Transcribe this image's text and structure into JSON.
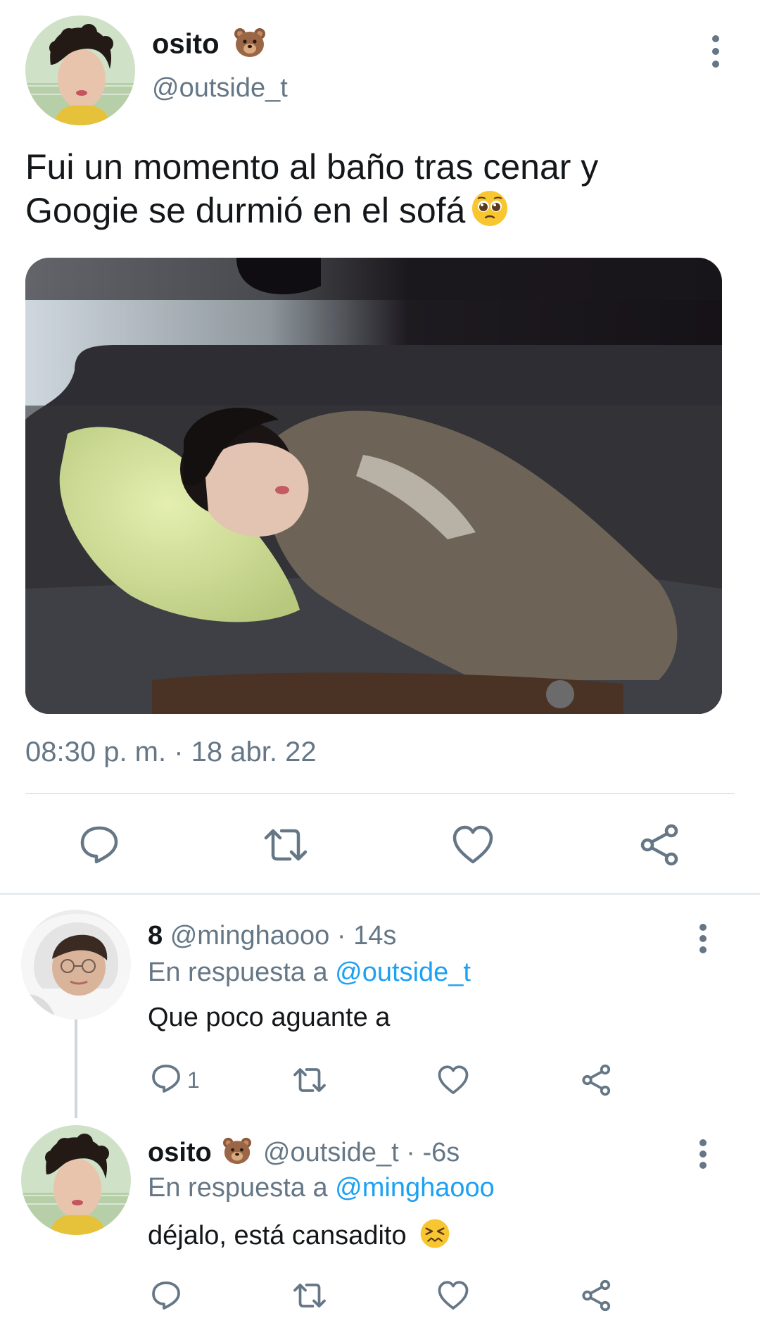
{
  "main_tweet": {
    "name": "osito",
    "name_emoji": "bear-face-emoji",
    "handle": "@outside_t",
    "text_line1": "Fui un momento al baño tras cenar y",
    "text_line2": "Googie se durmió en el sofá",
    "text_emoji": "pleading-face-emoji",
    "timestamp": "08:30 p. m. · 18 abr. 22"
  },
  "replies": [
    {
      "name": "8",
      "handle": "@minghaooo",
      "time": "· 14s",
      "in_reply_prefix": "En respuesta a",
      "in_reply_to": "@outside_t",
      "text": "Que poco aguante a",
      "reply_count": "1"
    },
    {
      "name": "osito",
      "name_emoji": "bear-face-emoji",
      "handle": "@outside_t",
      "time": "· -6s",
      "in_reply_prefix": "En respuesta a",
      "in_reply_to": "@minghaooo",
      "text": "déjalo, está cansadito",
      "text_emoji": "confounded-face-emoji"
    }
  ],
  "icons": {
    "reply": "reply-icon",
    "retweet": "retweet-icon",
    "like": "heart-icon",
    "share": "share-icon",
    "more": "more-vertical-icon"
  },
  "colors": {
    "text": "#14171a",
    "secondary": "#657786",
    "link": "#1da1f2",
    "divider": "#e1e8ed"
  }
}
